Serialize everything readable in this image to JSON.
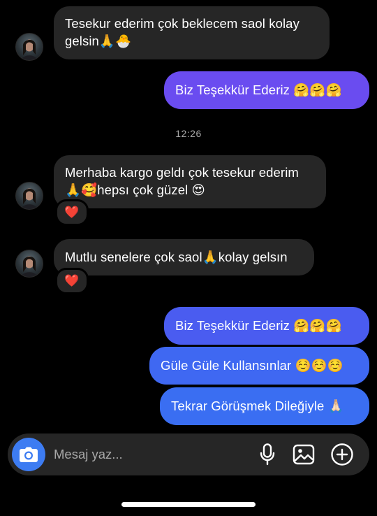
{
  "conversation": {
    "messages": [
      {
        "sender": "them",
        "line1": "Tesekur ederim çok beklecem saol kolay",
        "line2": "gelsin🙏🐣"
      },
      {
        "sender": "me",
        "text": "Biz Teşekkür Ederiz 🤗🤗🤗"
      },
      {
        "sender": "them",
        "line1": "Merhaba kargo geldı çok tesekur ederim",
        "line2": "🙏🥰hepsı çok güzel 😍",
        "reaction": "❤️"
      },
      {
        "sender": "them",
        "text": "Mutlu senelere çok saol🙏kolay gelsın",
        "reaction": "❤️"
      },
      {
        "sender": "me",
        "text": "Biz Teşekkür Ederiz 🤗🤗🤗"
      },
      {
        "sender": "me",
        "text": "Güle Güle Kullansınlar ☺️☺️☺️"
      },
      {
        "sender": "me",
        "text": "Tekrar Görüşmek Dileğiyle 🙏🏻"
      }
    ],
    "timestamp": "12:26"
  },
  "composer": {
    "placeholder": "Mesaj yaz..."
  },
  "colors": {
    "background": "#000000",
    "incoming_bubble": "#262626",
    "outgoing_purple": "#6a4cf0",
    "outgoing_blue": "#3d6df2",
    "camera_button": "#3d7cf2",
    "timestamp_text": "#a8a8a8",
    "reaction_heart": "#e0245e"
  },
  "icons": {
    "camera": "camera-icon",
    "microphone": "microphone-icon",
    "gallery": "gallery-icon",
    "add": "plus-circle-icon",
    "reaction": "heart"
  }
}
